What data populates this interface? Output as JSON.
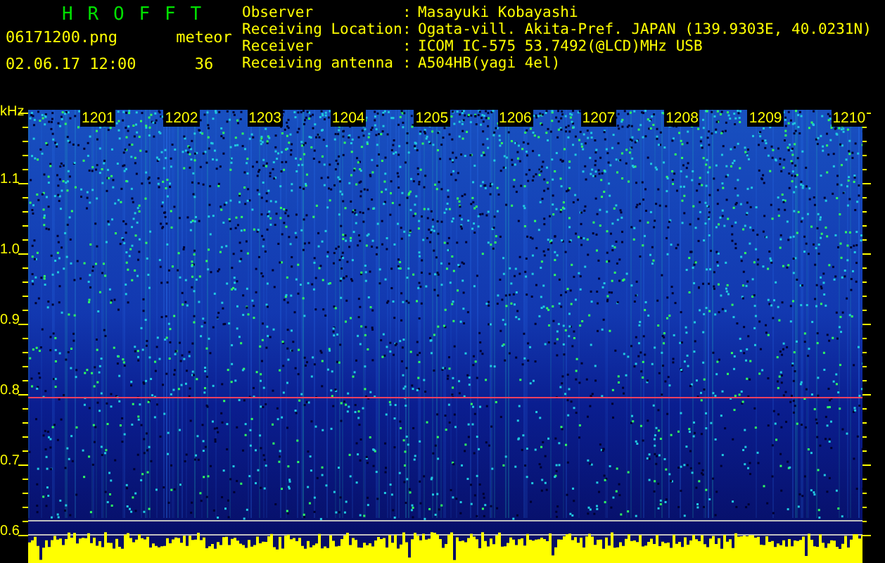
{
  "header": {
    "title": "H R O F F T",
    "filename": "06171200.png",
    "datetime": "02.06.17 12:00",
    "meteor_label": "meteor",
    "meteor_count": "36"
  },
  "info": [
    {
      "label": "Observer",
      "value": "Masayuki Kobayashi"
    },
    {
      "label": "Receiving Location",
      "value": "Ogata-vill. Akita-Pref. JAPAN (139.9303E, 40.0231N)"
    },
    {
      "label": "Receiver",
      "value": "ICOM IC-575 53.7492(@LCD)MHz USB"
    },
    {
      "label": "Receiving antenna",
      "value": "A504HB(yagi 4el)"
    }
  ],
  "separator": ":",
  "y_axis": {
    "unit": "kHz",
    "labels": [
      "1.1",
      "1.0",
      "0.9",
      "0.8",
      "0.7",
      "0.6"
    ]
  },
  "time_labels": [
    "1201",
    "1202",
    "1203",
    "1204",
    "1205",
    "1206",
    "1207",
    "1208",
    "1209",
    "1210"
  ]
}
